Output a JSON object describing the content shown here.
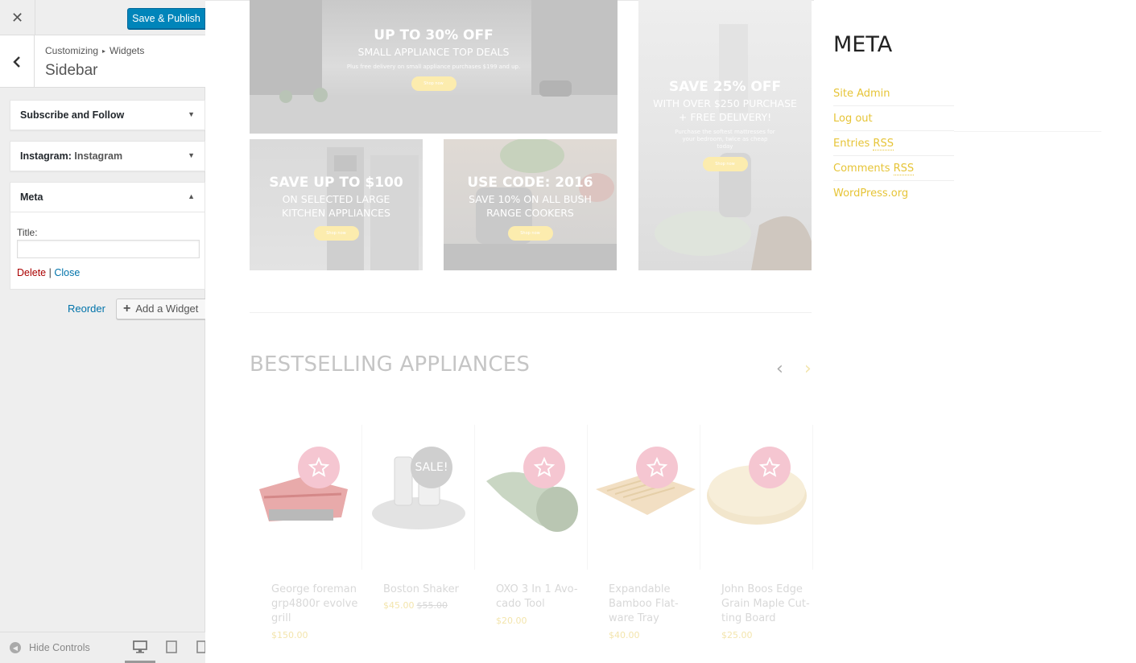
{
  "customizer": {
    "close_symbol": "✕",
    "publish_label": "Save & Publish",
    "breadcrumb": {
      "root": "Customizing",
      "sep": "▸",
      "section": "Widgets"
    },
    "section_title": "Sidebar",
    "widgets": [
      {
        "title": "Subscribe and Follow",
        "subtitle": "",
        "arrow": "▼"
      },
      {
        "title": "Instagram:",
        "subtitle": " Instagram",
        "arrow": "▼"
      },
      {
        "title": "Meta",
        "subtitle": "",
        "arrow": "▲"
      }
    ],
    "meta_form": {
      "title_label": "Title:",
      "title_value": "",
      "delete_label": "Delete",
      "separator": " | ",
      "close_label": "Close"
    },
    "reorder_label": "Reorder",
    "add_widget": {
      "plus": "+",
      "label": "Add a Widget"
    },
    "footer": {
      "hide_controls_label": "Hide Controls"
    },
    "icons": [
      "close-icon",
      "back-chevron-icon",
      "expand-arrow-icon",
      "collapse-arrow-icon",
      "plus-icon",
      "hide-controls-icon",
      "desktop-icon",
      "tablet-icon",
      "mobile-icon"
    ],
    "accent_color": "#0085ba"
  },
  "preview": {
    "banners": {
      "top": {
        "heading": "UP TO 30% OFF",
        "sub": "SMALL APPLIANCE TOP DEALS",
        "tiny": "Plus free delivery on small appliance purchases $199 and up.",
        "button": "Shop now"
      },
      "right": {
        "heading": "SAVE 25% OFF",
        "sub1": "WITH OVER $250 PURCHASE",
        "sub2": "+ FREE DELIVERY!",
        "tiny": "Purchase the softest mattresses for your bedroom, twice as cheap today",
        "button": "Shop now"
      },
      "left": {
        "heading": "SAVE UP TO $100",
        "sub1": "ON SELECTED LARGE",
        "sub2": "KITCHEN APPLIANCES",
        "button": "Shop now"
      },
      "mid": {
        "heading": "USE CODE: 2016",
        "sub1": "SAVE 10% ON ALL BUSH",
        "sub2": "RANGE COOKERS",
        "button": "Shop now"
      }
    },
    "bestselling": {
      "title": "BESTSELLING APPLIANCES",
      "prev": "‹",
      "next": "›",
      "products": [
        {
          "name1": "George foreman",
          "name2": "grp4800r evolve",
          "name3": "grill",
          "price": "$150.00",
          "old_price": "",
          "badge": "star"
        },
        {
          "name1": "Boston Shaker",
          "name2": "",
          "name3": "",
          "price": "$45.00",
          "old_price": "$55.00",
          "badge": "SALE!"
        },
        {
          "name1": "OXO 3 In 1 Avo-",
          "name2": "cado Tool",
          "name3": "",
          "price": "$20.00",
          "old_price": "",
          "badge": "star"
        },
        {
          "name1": "Expandable",
          "name2": "Bamboo Flat-",
          "name3": "ware Tray",
          "price": "$40.00",
          "old_price": "",
          "badge": "star"
        },
        {
          "name1": "John Boos Edge",
          "name2": "Grain Maple Cut-",
          "name3": "ting Board",
          "price": "$25.00",
          "old_price": "",
          "badge": "star"
        }
      ]
    },
    "meta": {
      "heading": "META",
      "links": [
        "Site Admin",
        "Log out",
        "Entries",
        "Comments",
        "WordPress.org"
      ],
      "rss": "RSS"
    },
    "link_color": "#e6c437"
  }
}
